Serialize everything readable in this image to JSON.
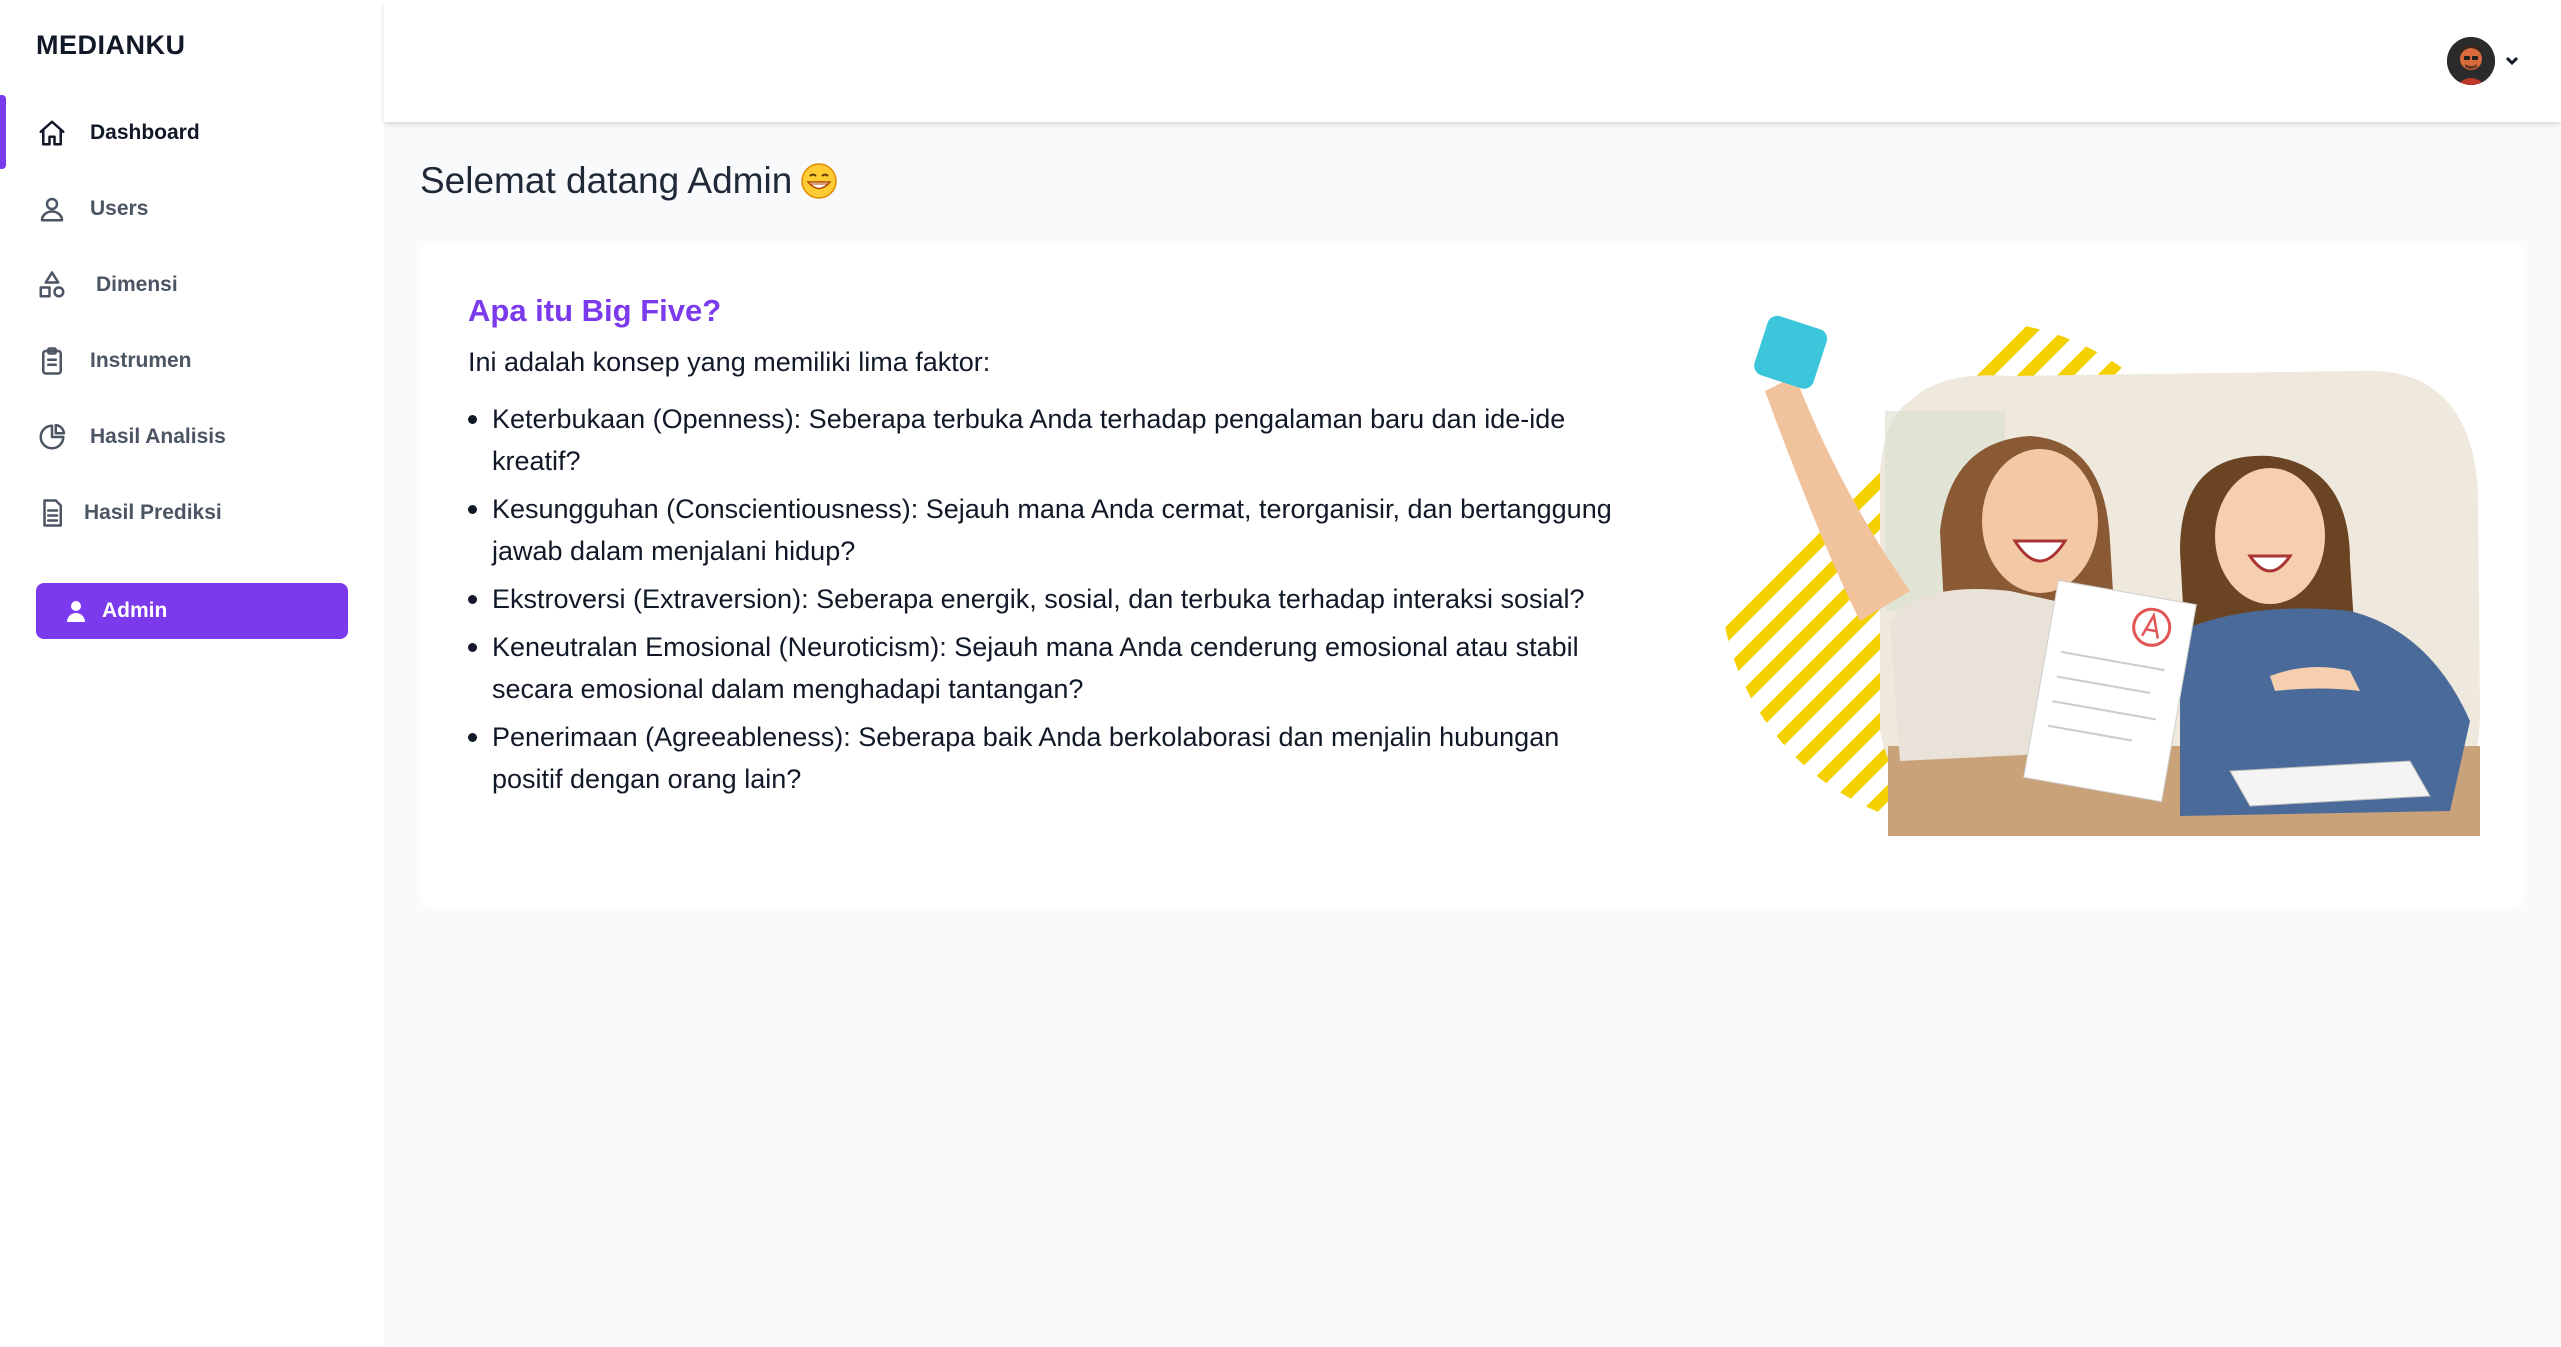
{
  "app": {
    "brand": "MEDIANKU"
  },
  "sidebar": {
    "items": [
      {
        "label": "Dashboard",
        "icon": "home-icon",
        "active": true
      },
      {
        "label": "Users",
        "icon": "user-icon",
        "active": false
      },
      {
        "label": "Dimensi",
        "icon": "shapes-icon",
        "active": false
      },
      {
        "label": "Instrumen",
        "icon": "clipboard-icon",
        "active": false
      },
      {
        "label": "Hasil Analisis",
        "icon": "pie-chart-icon",
        "active": false
      },
      {
        "label": "Hasil Prediksi",
        "icon": "document-icon",
        "active": false
      }
    ],
    "role_button": {
      "label": "Admin",
      "icon": "user-solid-icon"
    }
  },
  "header": {
    "avatar_icon": "avatar",
    "menu_icon": "chevron-down-icon"
  },
  "main": {
    "title": "Selemat datang Admin",
    "title_emoji": "grinning-face-emoji",
    "card": {
      "heading": "Apa itu Big Five?",
      "intro": "Ini adalah konsep yang memiliki lima faktor:",
      "factors": [
        "Keterbukaan (Openness): Seberapa terbuka Anda terhadap pengalaman baru dan ide-ide kreatif?",
        "Kesungguhan (Conscientiousness): Sejauh mana Anda cermat, terorganisir, dan bertanggung jawab dalam menjalani hidup?",
        "Ekstroversi (Extraversion): Seberapa energik, sosial, dan terbuka terhadap interaksi sosial?",
        "Keneutralan Emosional (Neuroticism): Sejauh mana Anda cenderung emosional atau stabil secara emosional dalam menghadapi tantangan?",
        "Penerimaan (Agreeableness): Seberapa baik Anda berkolaborasi dan menjalin hubungan positif dengan orang lain?"
      ]
    }
  },
  "colors": {
    "accent": "#7c3aed",
    "stripes": "#f5d000"
  }
}
